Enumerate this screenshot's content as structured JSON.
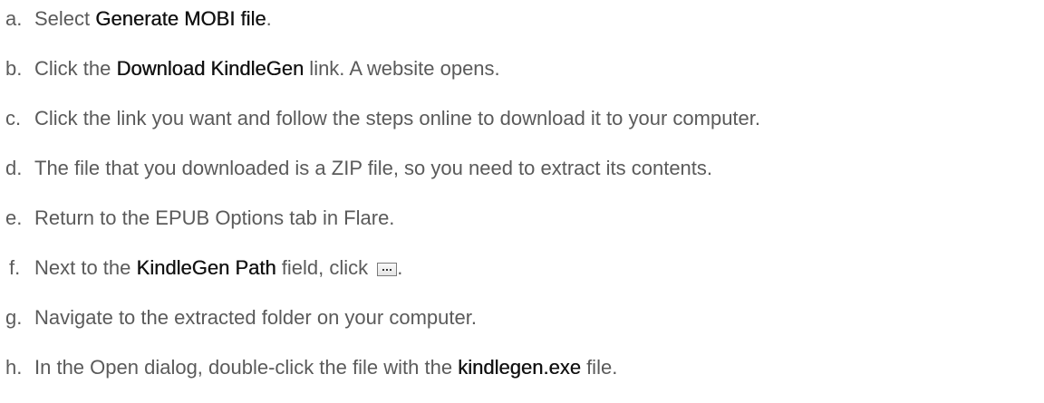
{
  "steps": [
    {
      "letter": "a.",
      "pre": "Select ",
      "bold": "Generate MOBI file",
      "post": "."
    },
    {
      "letter": "b.",
      "pre": "Click the ",
      "bold": "Download KindleGen",
      "post": " link. A website opens."
    },
    {
      "letter": "c.",
      "text": "Click the link you want and follow the steps online to download it to your computer."
    },
    {
      "letter": "d.",
      "text": "The file that you downloaded is a ZIP file, so you need to extract its contents."
    },
    {
      "letter": "e.",
      "text": "Return to the EPUB Options tab in Flare."
    },
    {
      "letter": "f.",
      "pre": "Next to the ",
      "bold": "KindleGen Path",
      "post": " field, click ",
      "icon": "browse-ellipsis-icon",
      "end": "."
    },
    {
      "letter": "g.",
      "text": "Navigate to the extracted folder on your computer."
    },
    {
      "letter": "h.",
      "pre": "In the Open dialog, double-click the file with the ",
      "bold": "kindlegen.exe",
      "post": " file."
    }
  ]
}
